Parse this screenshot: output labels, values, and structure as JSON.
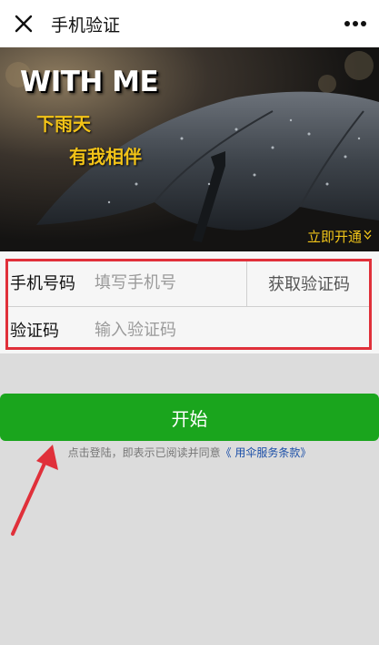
{
  "header": {
    "title": "手机验证",
    "close_icon": "close-icon",
    "more_icon": "more-dots-icon"
  },
  "banner": {
    "headline": "WITH ME",
    "line1": "下雨天",
    "line2": "有我相伴",
    "cta": "立即开通",
    "cta_icon": "double-chevron-down-icon"
  },
  "form": {
    "phone_label": "手机号码",
    "phone_placeholder": "填写手机号",
    "get_code": "获取验证码",
    "code_label": "验证码",
    "code_placeholder": "输入验证码"
  },
  "start_button": "开始",
  "agreement": {
    "text": "点击登陆，即表示已阅读并同意",
    "link": "《 用伞服务条款》"
  },
  "colors": {
    "primary_green": "#1aa51d",
    "highlight_red": "#e0303a",
    "banner_yellow": "#f2c318",
    "link_blue": "#1b4fa8"
  }
}
